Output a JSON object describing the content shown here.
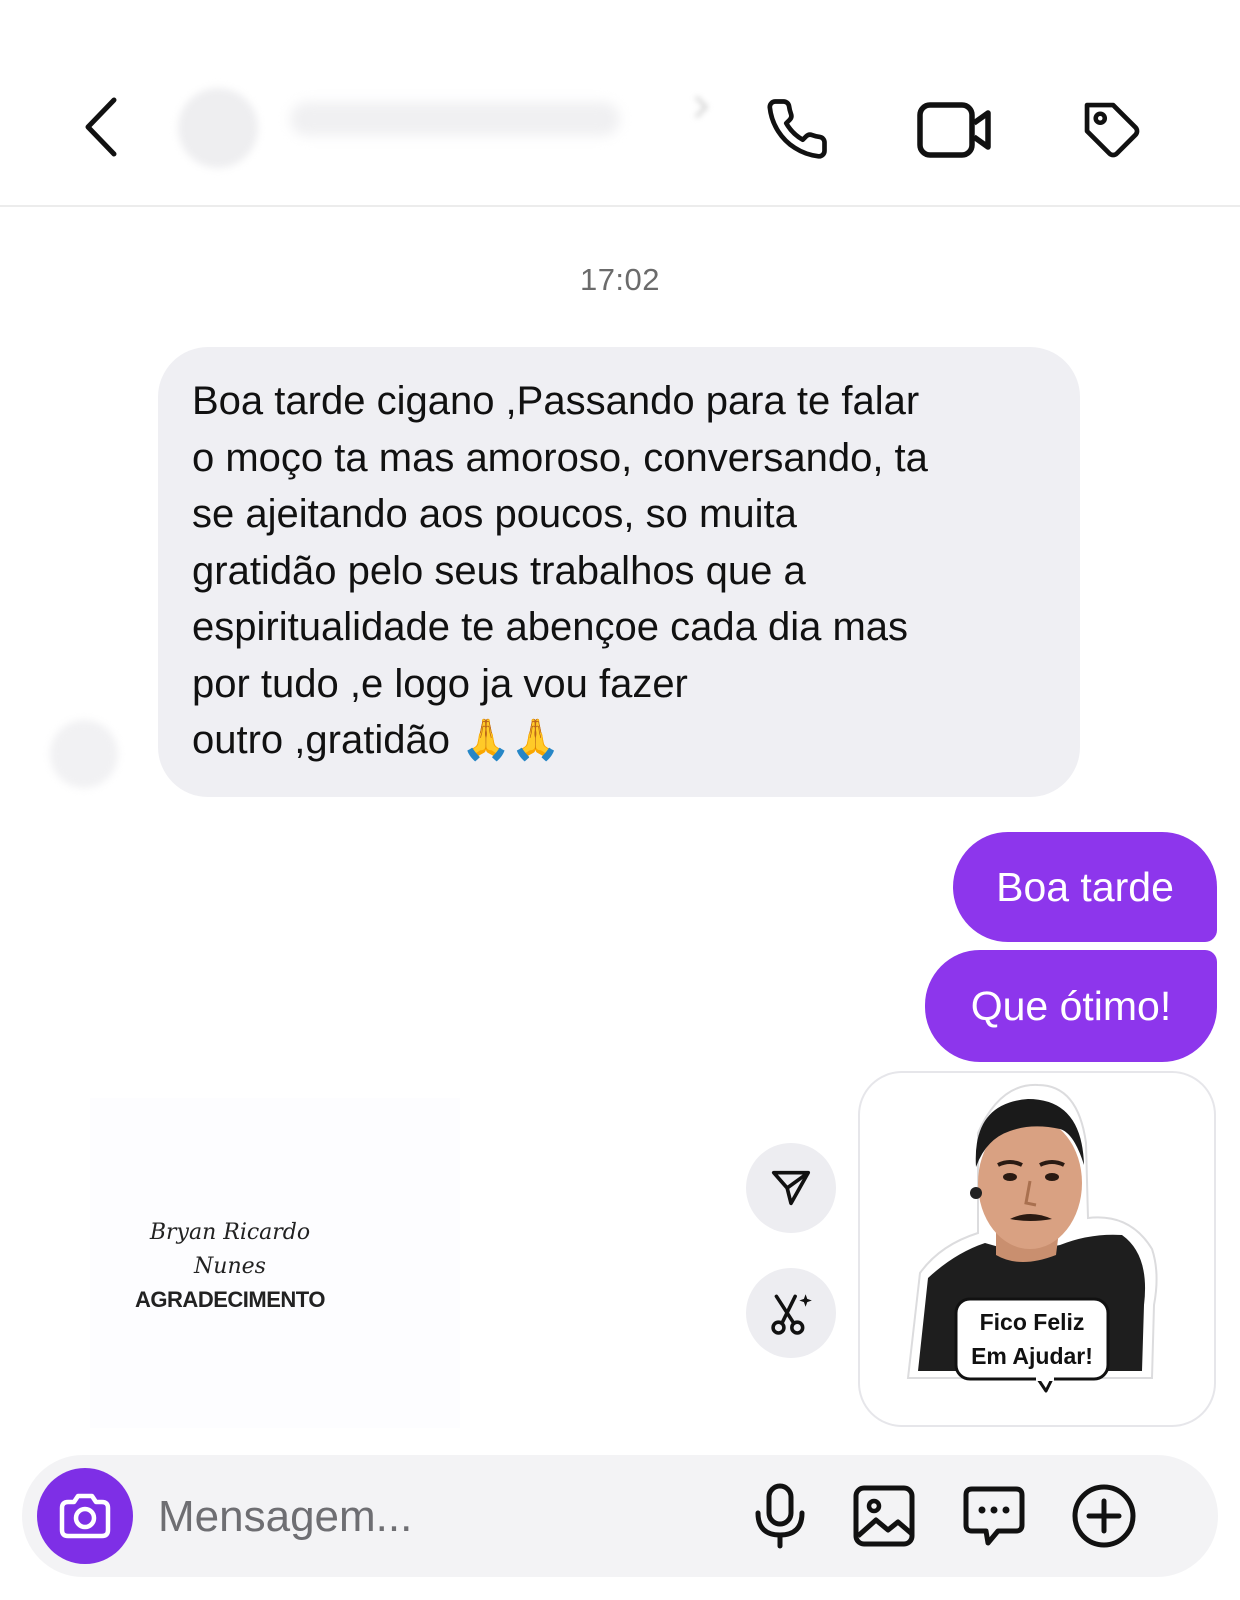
{
  "header": {
    "back_icon": "chevron-left-icon",
    "call_icon": "phone-icon",
    "video_icon": "video-camera-icon",
    "tag_icon": "tag-icon"
  },
  "chat": {
    "timestamp": "17:02",
    "incoming_message": "Boa tarde cigano ,Passando para te falar\no moço ta mas amoroso, conversando, ta\nse ajeitando aos poucos, so muita\ngratidão pelo seus trabalhos que a\nespiritualidade te abençoe cada dia mas\npor tudo ,e logo ja vou fazer\noutro ,gratidão 🙏🙏",
    "outgoing_messages": [
      "Boa tarde",
      "Que ótimo!"
    ],
    "image_card": {
      "signature": "Bryan Ricardo\nNunes",
      "caption": "AGRADECIMENTO"
    },
    "sticker": {
      "text_line_1": "Fico Feliz",
      "text_line_2": "Em Ajudar!"
    }
  },
  "composer": {
    "placeholder": "Mensagem...",
    "icons": [
      "camera-icon",
      "microphone-icon",
      "image-icon",
      "sticker-chat-icon",
      "plus-circle-icon"
    ]
  },
  "colors": {
    "outgoing_bubble": "#8d36ec",
    "incoming_bubble": "#efeff3",
    "camera_button": "#7e2fe6"
  }
}
